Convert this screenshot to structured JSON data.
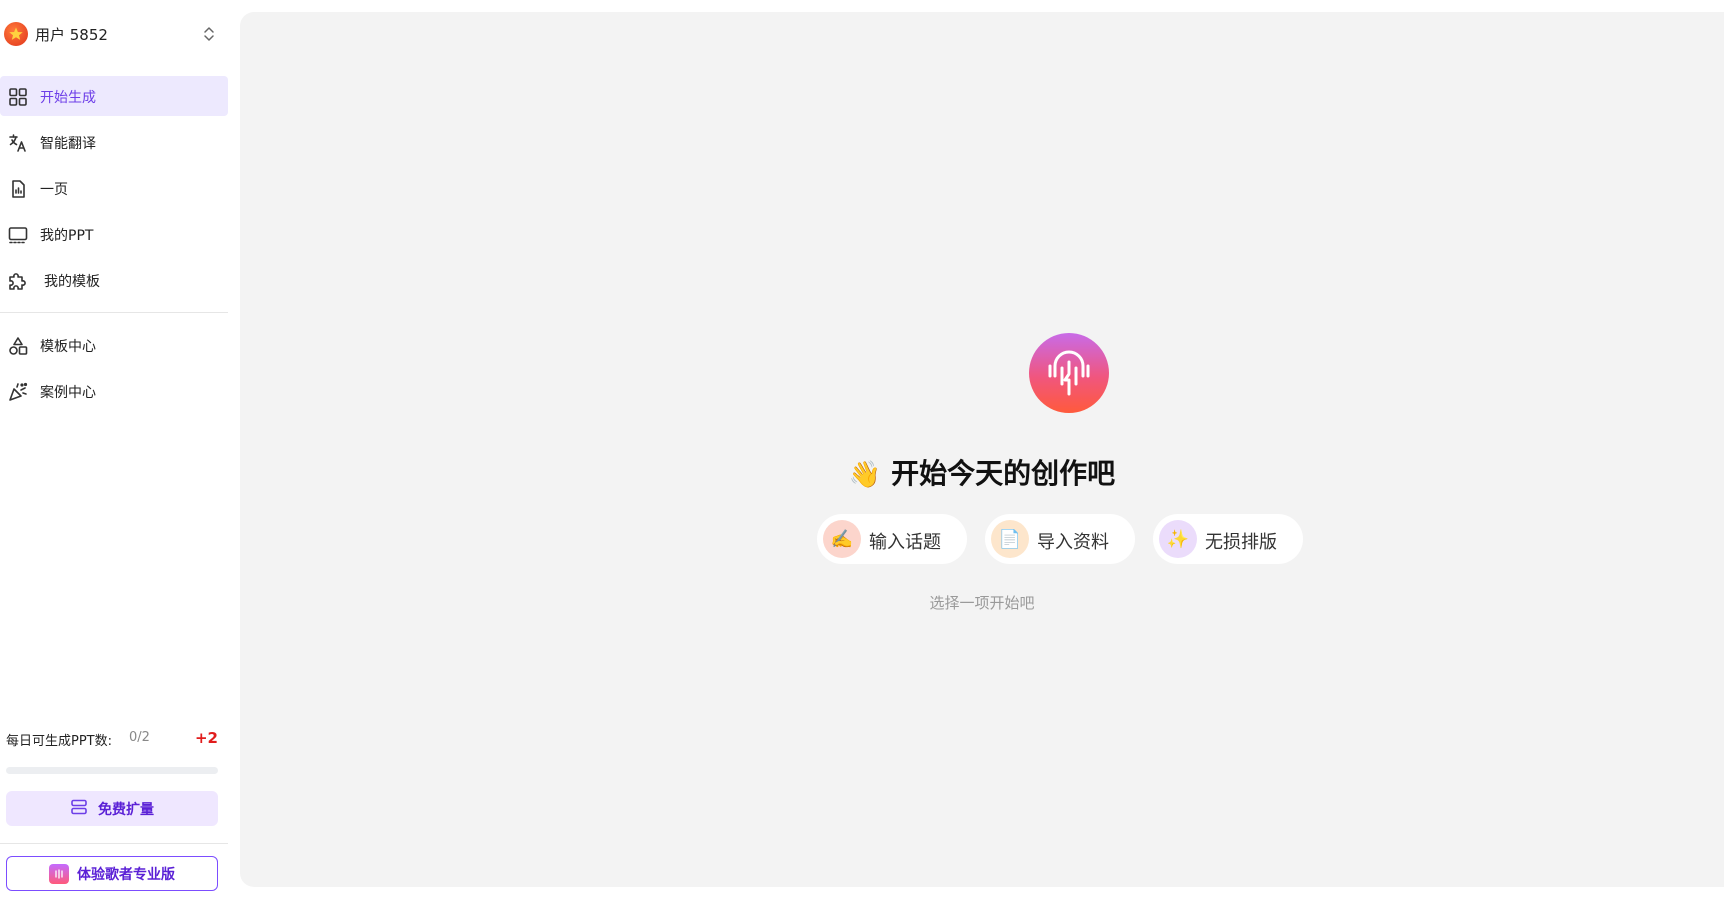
{
  "user": {
    "name": "用户 5852"
  },
  "nav": {
    "items": [
      {
        "label": "开始生成",
        "icon": "grid-icon",
        "active": true
      },
      {
        "label": "智能翻译",
        "icon": "translate-icon",
        "active": false
      },
      {
        "label": "一页",
        "icon": "file-chart-icon",
        "active": false
      },
      {
        "label": "我的PPT",
        "icon": "presentation-icon",
        "active": false
      },
      {
        "label": "我的模板",
        "icon": "puzzle-icon",
        "active": false
      }
    ],
    "secondary": [
      {
        "label": "模板中心",
        "icon": "shapes-icon"
      },
      {
        "label": "案例中心",
        "icon": "party-popper-icon"
      }
    ]
  },
  "quota": {
    "label": "每日可生成PPT数:",
    "value": "0/2",
    "plus": "+2",
    "progress": 0
  },
  "buttons": {
    "expand": "免费扩量",
    "pro": "体验歌者专业版"
  },
  "main": {
    "wave_emoji": "👋",
    "headline": "开始今天的创作吧",
    "chips": [
      {
        "label": "输入话题",
        "emoji": "✍",
        "bg": "#fcd5cc"
      },
      {
        "label": "导入资料",
        "emoji": "📄",
        "bg": "#fde6cc"
      },
      {
        "label": "无损排版",
        "emoji": "✨",
        "bg": "#ebdcfb"
      }
    ],
    "hint": "选择一项开始吧"
  },
  "colors": {
    "accent": "#6d3ee8",
    "active_bg": "#ede9fe",
    "main_bg": "#f3f3f3",
    "plus_red": "#e11d1d"
  }
}
